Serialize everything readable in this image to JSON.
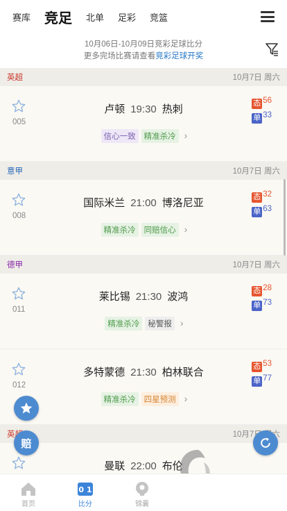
{
  "tabs": [
    {
      "label": "赛库",
      "active": false
    },
    {
      "label": "竞足",
      "active": true
    },
    {
      "label": "北单",
      "active": false
    },
    {
      "label": "足彩",
      "active": false
    },
    {
      "label": "竞篮",
      "active": false
    }
  ],
  "notice": {
    "line1": "10月06日-10月09日竞彩足球比分",
    "line2_prefix": "更多完场比赛请查看",
    "line2_link": "竞彩足球开奖"
  },
  "sections": [
    {
      "league": "英超",
      "league_color": "#c8382c",
      "date": "10月7日 周六",
      "match": {
        "num": "005",
        "home": "卢顿",
        "time": "19:30",
        "away": "热刺",
        "tags": [
          {
            "text": "信心一致",
            "style": "purple"
          },
          {
            "text": "精准杀冷",
            "style": "green"
          }
        ],
        "tai": "56",
        "dan": "33"
      }
    },
    {
      "league": "意甲",
      "league_color": "#2a6bb8",
      "date": "10月7日 周六",
      "match": {
        "num": "008",
        "home": "国际米兰",
        "time": "21:00",
        "away": "博洛尼亚",
        "tags": [
          {
            "text": "精准杀冷",
            "style": "green"
          },
          {
            "text": "同赔信心",
            "style": "green"
          }
        ],
        "tai": "32",
        "dan": "63"
      }
    },
    {
      "league": "德甲",
      "league_color": "#8a2aa8",
      "date": "10月7日 周六",
      "match": {
        "num": "011",
        "home": "莱比锡",
        "time": "21:30",
        "away": "波鸿",
        "tags": [
          {
            "text": "精准杀冷",
            "style": "green"
          },
          {
            "text": "秘警报",
            "style": "gray"
          }
        ],
        "tai": "28",
        "dan": "73"
      }
    },
    {
      "league": "",
      "league_color": "#c8382c",
      "date": "",
      "match": {
        "num": "012",
        "home": "多特蒙德",
        "time": "21:30",
        "away": "柏林联合",
        "tags": [
          {
            "text": "精准杀冷",
            "style": "green"
          },
          {
            "text": "四星预测",
            "style": "orange"
          }
        ],
        "tai": "53",
        "dan": "77"
      }
    },
    {
      "league": "英超",
      "league_color": "#c8382c",
      "date": "10月7日 周六",
      "match": {
        "num": "",
        "home": "曼联",
        "time": "22:00",
        "away": "布伦",
        "tags": [],
        "tai": "",
        "dan": ""
      }
    }
  ],
  "badges": {
    "tai": "态",
    "dan": "单"
  },
  "float": {
    "pei": "赔"
  },
  "nav": [
    {
      "label": "首页",
      "icon": "home-icon",
      "active": false
    },
    {
      "label": "比分",
      "icon": "score-icon",
      "active": true
    },
    {
      "label": "锦囊",
      "icon": "tips-icon",
      "active": false
    }
  ],
  "colors": {
    "accent": "#3c84d9",
    "link": "#2a79c8",
    "tai": "#e5552f",
    "dan": "#4b64c8"
  }
}
